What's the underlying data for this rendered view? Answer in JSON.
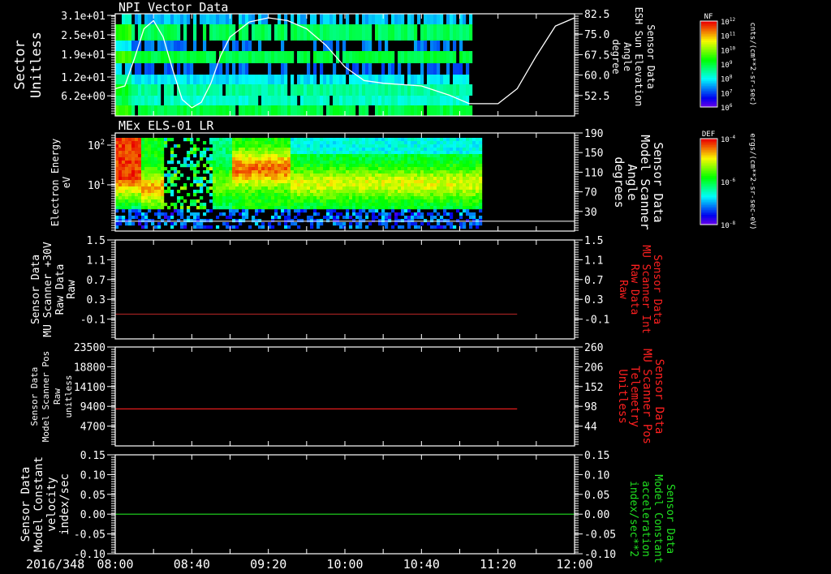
{
  "date_label": "2016/348",
  "x_ticks": [
    "08:00",
    "08:40",
    "09:20",
    "10:00",
    "10:40",
    "11:20",
    "12:00"
  ],
  "x_range": [
    "08:00",
    "12:00"
  ],
  "colors": {
    "red": "#ff2020",
    "green": "#20e020",
    "white": "#ffffff",
    "background": "#000000"
  },
  "panels": [
    {
      "title": "NPI Vector Data",
      "left_label": [
        "Sector",
        "Unitless"
      ],
      "right_label": [
        "Sensor Data",
        "ESH Sun Elevation",
        "Angle",
        "degree"
      ],
      "left_ticks": [
        "3.1e+01",
        "2.5e+01",
        "1.9e+01",
        "1.2e+01",
        "6.2e+00"
      ],
      "right_ticks": [
        "82.5",
        "75.0",
        "67.5",
        "60.0",
        "52.5"
      ]
    },
    {
      "title": "MEx ELS-01 LR",
      "left_label": [
        "Electron Energy",
        "eV"
      ],
      "right_label": [
        "Sensor Data",
        "Model Scanner",
        "Angle",
        "degrees"
      ],
      "left_ticks": [
        "10",
        "10"
      ],
      "left_tick_exponents": [
        "2",
        "1"
      ],
      "right_ticks": [
        "190",
        "150",
        "110",
        "70",
        "30"
      ]
    },
    {
      "left_label": [
        "Sensor Data",
        "MU Scanner +30V",
        "Raw Data",
        "Raw"
      ],
      "right_label": [
        "Sensor Data",
        "MU Scanner Int",
        "Raw Data",
        "Raw"
      ],
      "left_ticks": [
        "1.5",
        "1.1",
        "0.7",
        "0.3",
        "-0.1"
      ],
      "right_ticks": [
        "1.5",
        "1.1",
        "0.7",
        "0.3",
        "-0.1"
      ]
    },
    {
      "left_label": [
        "Sensor Data",
        "Model Scanner Pos",
        "Raw",
        "unitless"
      ],
      "right_label": [
        "Sensor Data",
        "MU Scanner Pos",
        "Telemetry",
        "Unitless"
      ],
      "left_ticks": [
        "23500",
        "18800",
        "14100",
        "9400",
        "4700"
      ],
      "right_ticks": [
        "260",
        "206",
        "152",
        "98",
        "44"
      ]
    },
    {
      "left_label": [
        "Sensor Data",
        "Model Constant",
        "velocity",
        "index/sec"
      ],
      "right_label": [
        "Sensor Data",
        "Model Constant",
        "acceleration",
        "index/sec**2"
      ],
      "left_ticks": [
        "0.15",
        "0.10",
        "0.05",
        "0.00",
        "-0.05",
        "-0.10"
      ],
      "right_ticks": [
        "0.15",
        "0.10",
        "0.05",
        "0.00",
        "-0.05",
        "-0.10"
      ]
    }
  ],
  "colorbars": [
    {
      "title": "NF",
      "tick_base": "10",
      "tick_exponents": [
        "12",
        "11",
        "10",
        "9",
        "8",
        "7",
        "6"
      ],
      "units": "cnts/(cm**2-sr-sec)"
    },
    {
      "title": "DEF",
      "tick_base": "10",
      "tick_exponents": [
        "-4",
        "-6",
        "-8"
      ],
      "units": "ergs/(cm**2-sr-sec-eV)"
    }
  ],
  "chart_data": [
    {
      "type": "heatmap",
      "title": "NPI Vector Data",
      "ylabel": "Sector Unitless",
      "ylim": [
        0,
        31.5
      ],
      "data_end": "11:05",
      "overlay": {
        "type": "line",
        "ylabel": "Sensor Data ESH Sun Elevation Angle degree",
        "ylim": [
          45,
          82.5
        ],
        "color": "#ffffff",
        "x": [
          "08:00",
          "08:05",
          "08:10",
          "08:15",
          "08:20",
          "08:25",
          "08:30",
          "08:35",
          "08:40",
          "08:45",
          "08:50",
          "08:55",
          "09:00",
          "09:10",
          "09:20",
          "09:30",
          "09:40",
          "09:50",
          "10:00",
          "10:10",
          "10:20",
          "10:40",
          "10:55",
          "11:05",
          "11:20",
          "11:30",
          "11:40",
          "11:50",
          "12:00"
        ],
        "y": [
          55,
          56,
          66,
          77,
          80,
          74,
          62,
          51,
          48,
          50,
          57,
          67,
          74,
          79.5,
          81,
          80,
          77,
          71,
          63,
          58,
          57,
          56,
          52.5,
          49.5,
          49.5,
          55,
          67,
          78,
          81
        ]
      }
    },
    {
      "type": "heatmap",
      "title": "MEx ELS-01 LR",
      "ylabel": "Electron Energy eV",
      "yscale": "log",
      "ylim": [
        0.7,
        200
      ],
      "data_end": "11:10",
      "colorbar": "DEF",
      "overlay": {
        "type": "line",
        "ylabel": "Sensor Data Model Scanner Angle degrees",
        "ylim": [
          -10,
          190
        ],
        "y_constant": 10,
        "color": "#ffffff"
      }
    },
    {
      "type": "line",
      "ylim": [
        -0.5,
        1.5
      ],
      "x": [
        "08:00",
        "11:30"
      ],
      "y": [
        0.0,
        0.0
      ],
      "color": "#a02020"
    },
    {
      "type": "line",
      "ylim": [
        0,
        23500
      ],
      "right_ylim": [
        -10,
        260
      ],
      "x": [
        "08:00",
        "11:30"
      ],
      "y": [
        8800,
        8800
      ],
      "color": "#ff2020"
    },
    {
      "type": "line",
      "ylim": [
        -0.1,
        0.15
      ],
      "x": [
        "08:00",
        "12:00"
      ],
      "y": [
        0.0,
        0.0
      ],
      "color": "#20e020"
    }
  ]
}
